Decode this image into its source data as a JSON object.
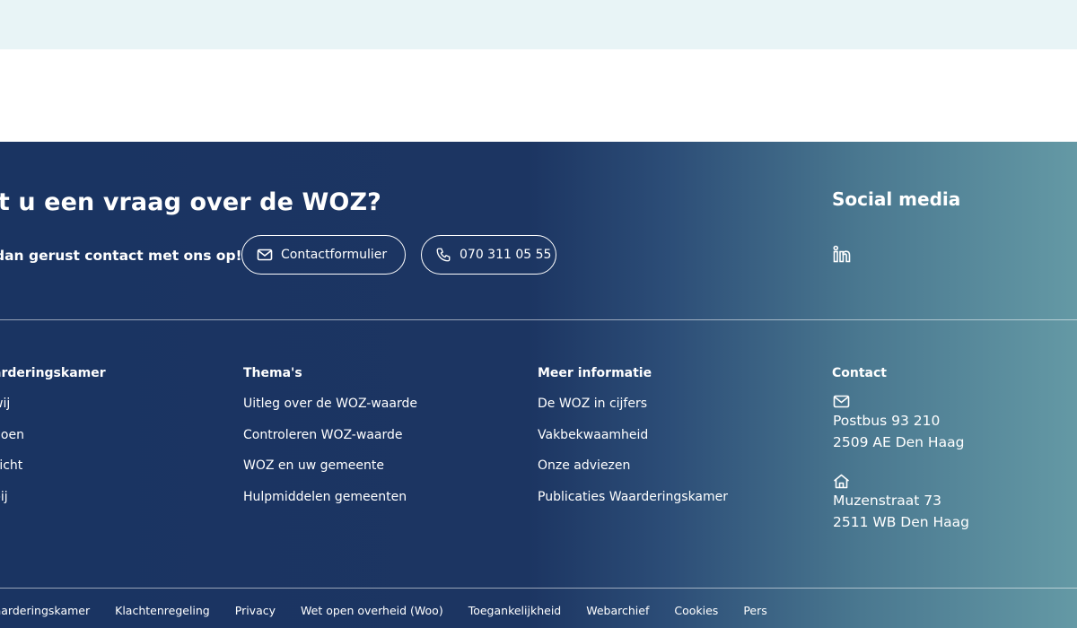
{
  "cta": {
    "title": "ft u een vraag over de WOZ?",
    "text": "dan gerust contact met ons op!",
    "contact_button": "Contactformulier",
    "phone_button": "070 311 05 55"
  },
  "social": {
    "title": "Social media",
    "icons": [
      "linkedin-icon"
    ]
  },
  "columns": [
    {
      "title": "arderingskamer",
      "items": [
        "wij",
        "doen",
        "zicht",
        "bij"
      ]
    },
    {
      "title": "Thema's",
      "items": [
        "Uitleg over de WOZ-waarde",
        "Controleren WOZ-waarde",
        "WOZ en uw gemeente",
        "Hulpmiddelen gemeenten"
      ]
    },
    {
      "title": "Meer informatie",
      "items": [
        "De WOZ in cijfers",
        "Vakbekwaamheid",
        "Onze adviezen",
        "Publicaties Waarderingskamer"
      ]
    }
  ],
  "contact": {
    "title": "Contact",
    "postal_line1": "Postbus 93 210",
    "postal_line2": "2509 AE Den Haag",
    "visit_line1": "Muzenstraat 73",
    "visit_line2": "2511 WB Den Haag"
  },
  "bottom_links": [
    "Vaarderingskamer",
    "Klachtenregeling",
    "Privacy",
    "Wet open overheid (Woo)",
    "Toegankelijkheid",
    "Webarchief",
    "Cookies",
    "Pers"
  ],
  "colors": {
    "footer_dark": "#1a3462",
    "footer_light": "#6499a5",
    "top_band": "#e8f4f6"
  }
}
